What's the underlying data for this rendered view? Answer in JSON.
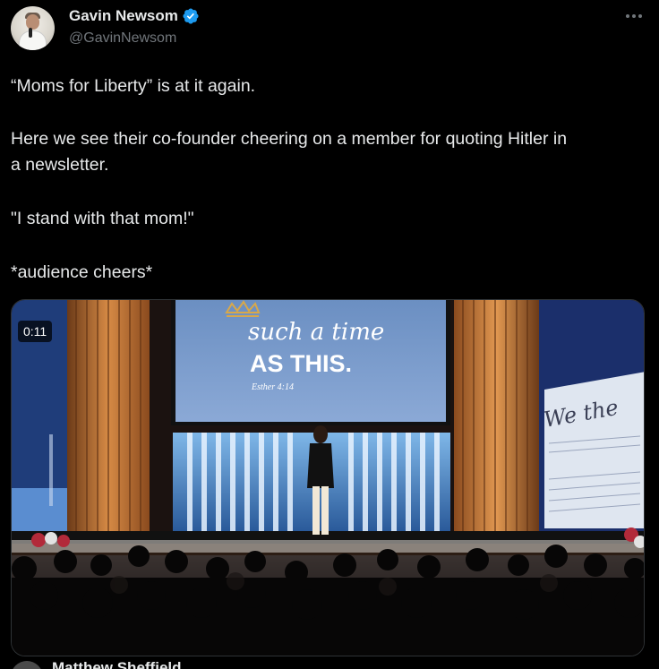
{
  "author": {
    "display_name": "Gavin Newsom",
    "handle": "@GavinNewsom",
    "verified": true,
    "verified_color": "#1d9bf0"
  },
  "tweet": {
    "lines": [
      "“Moms for Liberty” is at it again.",
      "Here we see their co-founder cheering on a member for quoting Hitler in",
      "a newsletter.",
      "\"I stand with that mom!\"",
      "*audience cheers*"
    ]
  },
  "video": {
    "duration": "0:11",
    "screen_script": "such a time",
    "screen_headline": "AS THIS.",
    "screen_reference": "Esther 4:14",
    "banner_script": "We the"
  },
  "next_tweet": {
    "author_partial": "Matthew Sheffield"
  },
  "icons": {
    "verified": "verified-badge-icon",
    "more": "more-options-icon",
    "crown": "crown-icon"
  },
  "colors": {
    "background": "#000000",
    "text_primary": "#e7e9ea",
    "text_secondary": "#71767b",
    "accent": "#1d9bf0"
  }
}
